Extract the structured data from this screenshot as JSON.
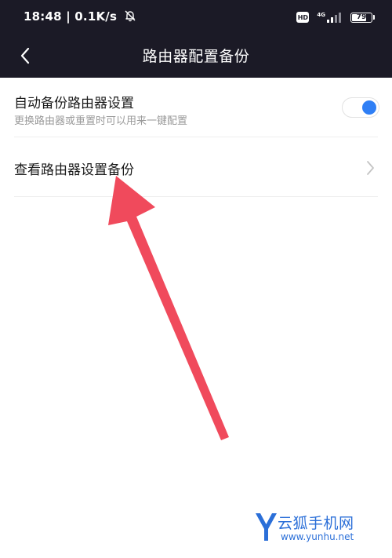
{
  "status_bar": {
    "time": "18:48",
    "network_speed": "0.1K/s",
    "mute_icon": "bell-off-icon",
    "hd_label": "HD",
    "network_type": "4G",
    "battery_level": "79",
    "battery_fraction": 0.79
  },
  "nav": {
    "back_icon": "chevron-left-icon",
    "title": "路由器配置备份"
  },
  "settings": {
    "auto_backup": {
      "title": "自动备份路由器设置",
      "subtitle": "更换路由器或重置时可以用来一键配置",
      "enabled": true
    },
    "view_backup": {
      "title": "查看路由器设置备份",
      "icon": "chevron-right-icon"
    }
  },
  "annotation": {
    "arrow_color": "#f04a5c"
  },
  "watermark": {
    "logo_letter": "Y",
    "name": "云狐手机网",
    "url": "www.yunhu.net"
  },
  "colors": {
    "header_bg": "#1b1a26",
    "toggle_accent": "#2f7ff5",
    "watermark_blue": "#2b6fd8"
  }
}
